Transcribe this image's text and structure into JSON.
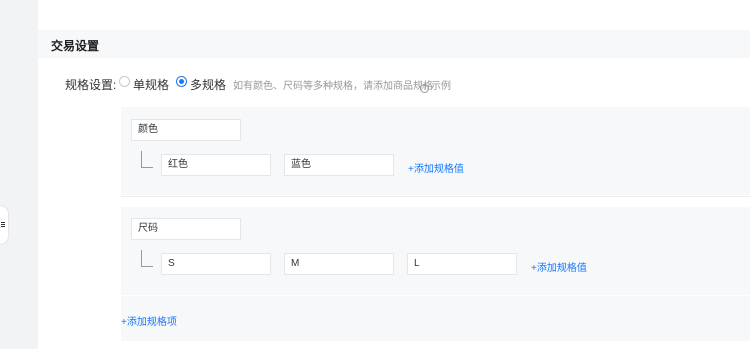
{
  "section": {
    "title": "交易设置"
  },
  "spec_setting": {
    "label": "规格设置:",
    "options": [
      {
        "label": "单规格",
        "checked": false
      },
      {
        "label": "多规格",
        "checked": true
      }
    ],
    "hint": "如有颜色、尺码等多种规格，请添加商品规格",
    "example_label": "示例",
    "example_icon": "question-circle-icon"
  },
  "spec_groups": [
    {
      "name": "颜色",
      "values": [
        "红色",
        "蓝色"
      ],
      "add_value_label": "+添加规格值"
    },
    {
      "name": "尺码",
      "values": [
        "S",
        "M",
        "L"
      ],
      "add_value_label": "+添加规格值"
    }
  ],
  "add_spec_item_label": "+添加规格项",
  "side_handle_icon": "menu-icon",
  "colors": {
    "accent": "#1677ff",
    "panel_bg": "#f7f8fa",
    "page_bg": "#f2f3f5"
  }
}
